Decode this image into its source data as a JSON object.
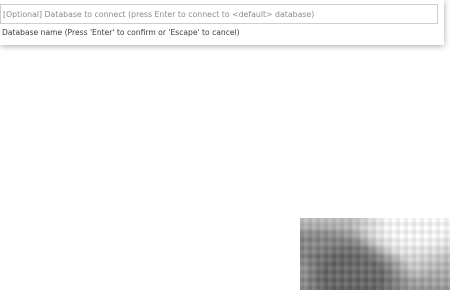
{
  "quick_input": {
    "placeholder": "[Optional] Database to connect (press Enter to connect to <default> database)",
    "value": "",
    "message": "Database name (Press 'Enter' to confirm or 'Escape' to cancel)"
  }
}
